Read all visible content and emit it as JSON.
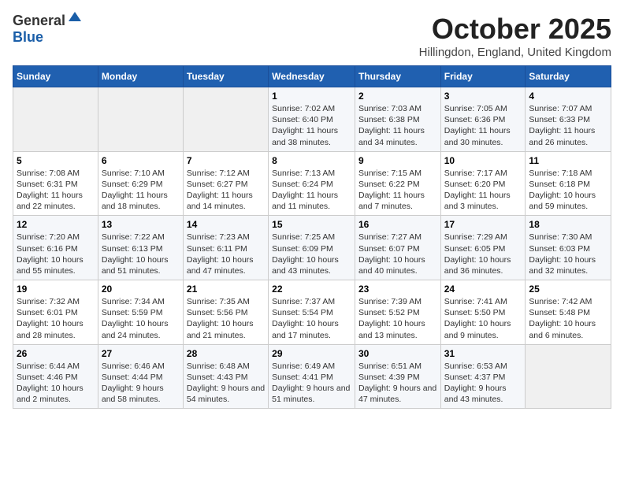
{
  "header": {
    "logo_general": "General",
    "logo_blue": "Blue",
    "month_year": "October 2025",
    "location": "Hillingdon, England, United Kingdom"
  },
  "days_of_week": [
    "Sunday",
    "Monday",
    "Tuesday",
    "Wednesday",
    "Thursday",
    "Friday",
    "Saturday"
  ],
  "weeks": [
    [
      {
        "day": "",
        "info": ""
      },
      {
        "day": "",
        "info": ""
      },
      {
        "day": "",
        "info": ""
      },
      {
        "day": "1",
        "info": "Sunrise: 7:02 AM\nSunset: 6:40 PM\nDaylight: 11 hours and 38 minutes."
      },
      {
        "day": "2",
        "info": "Sunrise: 7:03 AM\nSunset: 6:38 PM\nDaylight: 11 hours and 34 minutes."
      },
      {
        "day": "3",
        "info": "Sunrise: 7:05 AM\nSunset: 6:36 PM\nDaylight: 11 hours and 30 minutes."
      },
      {
        "day": "4",
        "info": "Sunrise: 7:07 AM\nSunset: 6:33 PM\nDaylight: 11 hours and 26 minutes."
      }
    ],
    [
      {
        "day": "5",
        "info": "Sunrise: 7:08 AM\nSunset: 6:31 PM\nDaylight: 11 hours and 22 minutes."
      },
      {
        "day": "6",
        "info": "Sunrise: 7:10 AM\nSunset: 6:29 PM\nDaylight: 11 hours and 18 minutes."
      },
      {
        "day": "7",
        "info": "Sunrise: 7:12 AM\nSunset: 6:27 PM\nDaylight: 11 hours and 14 minutes."
      },
      {
        "day": "8",
        "info": "Sunrise: 7:13 AM\nSunset: 6:24 PM\nDaylight: 11 hours and 11 minutes."
      },
      {
        "day": "9",
        "info": "Sunrise: 7:15 AM\nSunset: 6:22 PM\nDaylight: 11 hours and 7 minutes."
      },
      {
        "day": "10",
        "info": "Sunrise: 7:17 AM\nSunset: 6:20 PM\nDaylight: 11 hours and 3 minutes."
      },
      {
        "day": "11",
        "info": "Sunrise: 7:18 AM\nSunset: 6:18 PM\nDaylight: 10 hours and 59 minutes."
      }
    ],
    [
      {
        "day": "12",
        "info": "Sunrise: 7:20 AM\nSunset: 6:16 PM\nDaylight: 10 hours and 55 minutes."
      },
      {
        "day": "13",
        "info": "Sunrise: 7:22 AM\nSunset: 6:13 PM\nDaylight: 10 hours and 51 minutes."
      },
      {
        "day": "14",
        "info": "Sunrise: 7:23 AM\nSunset: 6:11 PM\nDaylight: 10 hours and 47 minutes."
      },
      {
        "day": "15",
        "info": "Sunrise: 7:25 AM\nSunset: 6:09 PM\nDaylight: 10 hours and 43 minutes."
      },
      {
        "day": "16",
        "info": "Sunrise: 7:27 AM\nSunset: 6:07 PM\nDaylight: 10 hours and 40 minutes."
      },
      {
        "day": "17",
        "info": "Sunrise: 7:29 AM\nSunset: 6:05 PM\nDaylight: 10 hours and 36 minutes."
      },
      {
        "day": "18",
        "info": "Sunrise: 7:30 AM\nSunset: 6:03 PM\nDaylight: 10 hours and 32 minutes."
      }
    ],
    [
      {
        "day": "19",
        "info": "Sunrise: 7:32 AM\nSunset: 6:01 PM\nDaylight: 10 hours and 28 minutes."
      },
      {
        "day": "20",
        "info": "Sunrise: 7:34 AM\nSunset: 5:59 PM\nDaylight: 10 hours and 24 minutes."
      },
      {
        "day": "21",
        "info": "Sunrise: 7:35 AM\nSunset: 5:56 PM\nDaylight: 10 hours and 21 minutes."
      },
      {
        "day": "22",
        "info": "Sunrise: 7:37 AM\nSunset: 5:54 PM\nDaylight: 10 hours and 17 minutes."
      },
      {
        "day": "23",
        "info": "Sunrise: 7:39 AM\nSunset: 5:52 PM\nDaylight: 10 hours and 13 minutes."
      },
      {
        "day": "24",
        "info": "Sunrise: 7:41 AM\nSunset: 5:50 PM\nDaylight: 10 hours and 9 minutes."
      },
      {
        "day": "25",
        "info": "Sunrise: 7:42 AM\nSunset: 5:48 PM\nDaylight: 10 hours and 6 minutes."
      }
    ],
    [
      {
        "day": "26",
        "info": "Sunrise: 6:44 AM\nSunset: 4:46 PM\nDaylight: 10 hours and 2 minutes."
      },
      {
        "day": "27",
        "info": "Sunrise: 6:46 AM\nSunset: 4:44 PM\nDaylight: 9 hours and 58 minutes."
      },
      {
        "day": "28",
        "info": "Sunrise: 6:48 AM\nSunset: 4:43 PM\nDaylight: 9 hours and 54 minutes."
      },
      {
        "day": "29",
        "info": "Sunrise: 6:49 AM\nSunset: 4:41 PM\nDaylight: 9 hours and 51 minutes."
      },
      {
        "day": "30",
        "info": "Sunrise: 6:51 AM\nSunset: 4:39 PM\nDaylight: 9 hours and 47 minutes."
      },
      {
        "day": "31",
        "info": "Sunrise: 6:53 AM\nSunset: 4:37 PM\nDaylight: 9 hours and 43 minutes."
      },
      {
        "day": "",
        "info": ""
      }
    ]
  ]
}
